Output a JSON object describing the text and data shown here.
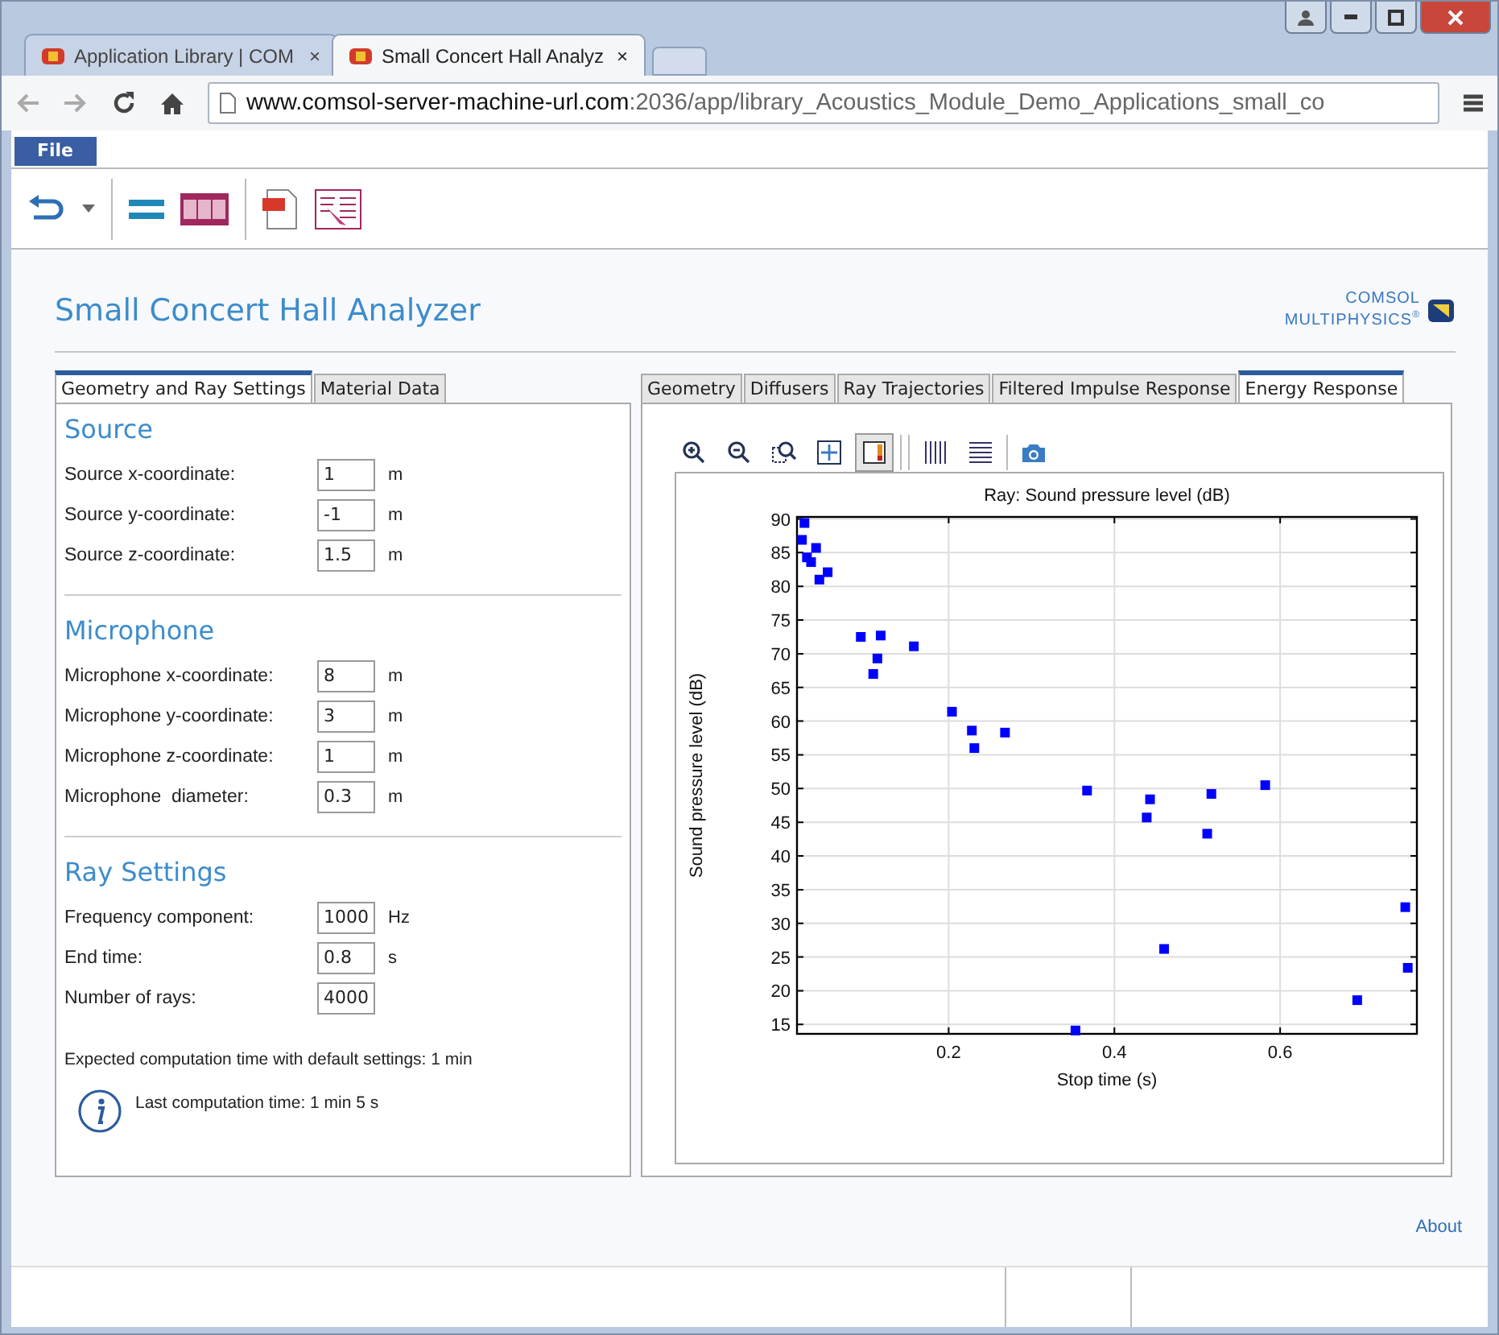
{
  "browser": {
    "tabs": [
      {
        "title": "Application Library | COM",
        "selected": false,
        "close": "×"
      },
      {
        "title": "Small Concert Hall Analyz",
        "selected": true,
        "close": "×"
      }
    ],
    "url_host": "www.comsol-server-machine-url.com",
    "url_path": ":2036/app/library_Acoustics_Module_Demo_Applications_small_co"
  },
  "menu": {
    "label": "File"
  },
  "app": {
    "title": "Small Concert Hall Analyzer",
    "logo_line1": "COMSOL",
    "logo_line2": "MULTIPHYSICS",
    "logo_mark": "®"
  },
  "left_tabs": [
    {
      "label": "Geometry and Ray Settings",
      "selected": true
    },
    {
      "label": "Material Data",
      "selected": false
    }
  ],
  "sections": [
    {
      "heading": "Source",
      "fields": [
        {
          "label": "Source x-coordinate:",
          "value": "1",
          "unit": "m"
        },
        {
          "label": "Source y-coordinate:",
          "value": "-1",
          "unit": "m"
        },
        {
          "label": "Source z-coordinate:",
          "value": "1.5",
          "unit": "m"
        }
      ]
    },
    {
      "heading": "Microphone",
      "fields": [
        {
          "label": "Microphone x-coordinate:",
          "value": "8",
          "unit": "m"
        },
        {
          "label": "Microphone y-coordinate:",
          "value": "3",
          "unit": "m"
        },
        {
          "label": "Microphone z-coordinate:",
          "value": "1",
          "unit": "m"
        },
        {
          "label": "Microphone  diameter:",
          "value": "0.3",
          "unit": "m"
        }
      ]
    },
    {
      "heading": "Ray Settings",
      "fields": [
        {
          "label": "Frequency component:",
          "value": "1000",
          "unit": "Hz"
        },
        {
          "label": "End time:",
          "value": "0.8",
          "unit": "s"
        },
        {
          "label": "Number of rays:",
          "value": "4000"
        }
      ]
    }
  ],
  "expected_time": "Expected computation time with default settings:  1 min",
  "last_time": "Last computation time: 1 min 5 s",
  "right_tabs": [
    {
      "label": "Geometry",
      "selected": false
    },
    {
      "label": "Diffusers",
      "selected": false
    },
    {
      "label": "Ray Trajectories",
      "selected": false
    },
    {
      "label": "Filtered Impulse Response",
      "selected": false
    },
    {
      "label": "Energy Response",
      "selected": true
    }
  ],
  "plot_tools": [
    {
      "kind": "zoom-in",
      "selected": false
    },
    {
      "kind": "zoom-out",
      "selected": false
    },
    {
      "kind": "zoom-box",
      "selected": false
    },
    {
      "kind": "zoom-extents",
      "selected": false
    },
    {
      "kind": "legend",
      "selected": true
    },
    {
      "kind": "grid-x",
      "selected": false
    },
    {
      "kind": "grid-y",
      "selected": false
    },
    {
      "kind": "camera",
      "selected": false
    }
  ],
  "plot": {
    "chart_data": {
      "type": "scatter",
      "title": "Ray: Sound pressure level (dB)",
      "xlabel": "Stop time (s)",
      "ylabel": "Sound pressure level (dB)",
      "x": [
        0.026,
        0.023,
        0.029,
        0.034,
        0.04,
        0.044,
        0.054,
        0.094,
        0.118,
        0.114,
        0.109,
        0.158,
        0.204,
        0.228,
        0.231,
        0.268,
        0.367,
        0.443,
        0.439,
        0.517,
        0.512,
        0.582,
        0.46,
        0.353,
        0.693,
        0.751,
        0.754
      ],
      "series": [
        {
          "color": "#0000ff",
          "values": [
            89.4,
            86.9,
            84.3,
            83.6,
            85.7,
            81.0,
            82.1,
            72.5,
            72.7,
            69.3,
            67.0,
            71.1,
            61.4,
            58.6,
            56.0,
            58.3,
            49.7,
            48.4,
            45.7,
            49.2,
            43.3,
            50.5,
            26.2,
            14.1,
            18.6,
            32.4,
            23.4
          ]
        }
      ],
      "grid": true,
      "xlim": [
        0.017,
        0.765
      ],
      "ylim": [
        13.6,
        90.3
      ],
      "xticks": [
        0.2,
        0.4,
        0.6
      ],
      "yticks": [
        15,
        20,
        25,
        30,
        35,
        40,
        45,
        50,
        55,
        60,
        65,
        70,
        75,
        80,
        85,
        90
      ]
    }
  },
  "about": "About"
}
